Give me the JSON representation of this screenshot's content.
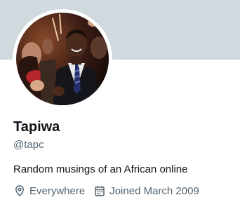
{
  "profile": {
    "display_name": "Tapiwa",
    "handle": "@tapc",
    "bio": "Random musings of an African online",
    "location": "Everywhere",
    "joined": "Joined March 2009",
    "banner_color": "#cfd9de"
  },
  "icons": {
    "location": "map-pin-icon",
    "joined": "calendar-icon"
  }
}
